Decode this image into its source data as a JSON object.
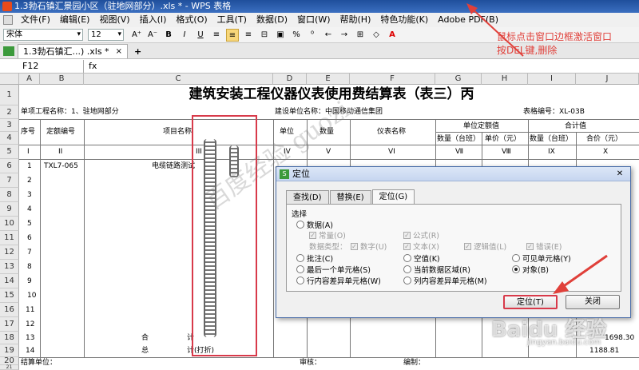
{
  "window": {
    "title": "1.3勃石镇汇景园小区（驻地网部分）.xls * - WPS 表格"
  },
  "menu": [
    "文件(F)",
    "编辑(E)",
    "视图(V)",
    "插入(I)",
    "格式(O)",
    "工具(T)",
    "数据(D)",
    "窗口(W)",
    "帮助(H)",
    "特色功能(K)",
    "Adobe PDF(B)"
  ],
  "toolbar": {
    "font": "宋体",
    "size": "12",
    "buttons": [
      "A⁺",
      "A⁻",
      "B",
      "I",
      "U",
      "≡",
      "≡",
      "≡",
      "⊟",
      "▣",
      "%",
      "⁰",
      "←",
      "→",
      "⊞",
      "◇",
      "A"
    ]
  },
  "doc_tab": {
    "label": "1.3勃石镇汇...) .xls *",
    "close": "×",
    "add": "+"
  },
  "formula_bar": {
    "cell_ref": "F12",
    "fx": "fx"
  },
  "columns": [
    "A",
    "B",
    "C",
    "D",
    "E",
    "F",
    "G",
    "H",
    "I",
    "J"
  ],
  "rows": [
    "1",
    "2",
    "3",
    "4",
    "5",
    "6",
    "7",
    "8",
    "9",
    "10",
    "11",
    "12",
    "13",
    "14",
    "15",
    "16",
    "17",
    "18",
    "19",
    "20",
    "21"
  ],
  "sheet": {
    "title": "建筑安装工程仪器仪表使用费结算表（表三）丙",
    "project_name": "单项工程名称：1、驻地网部分",
    "builder": "建设单位名称：中国移动通信集团",
    "table_no": "表格编号：XL-03B",
    "h_seq": "序号",
    "h_quota": "定额编号",
    "h_item": "项目名称",
    "h_unit": "单位",
    "h_qty": "数量",
    "h_meter": "仪表名称",
    "h_unit_quota": "单位定额值",
    "h_total": "合计值",
    "h_qty_shift": "数量（台班）",
    "h_unit_price": "单价（元）",
    "h_qty_shift2": "数量（台班）",
    "h_total_price": "合价（元）",
    "r5": [
      "I",
      "II",
      "III",
      "IV",
      "V",
      "VI",
      "Ⅶ",
      "Ⅷ",
      "IX",
      "X"
    ],
    "r6": [
      "1",
      "TXL7-065",
      "电缆链路测试"
    ],
    "row_numbers": [
      "2",
      "3",
      "4",
      "5",
      "6",
      "7",
      "8",
      "9",
      "10",
      "11",
      "12"
    ],
    "r18": [
      "13",
      "合",
      "计"
    ],
    "r19": [
      "14",
      "总",
      "计(打折)"
    ],
    "r18_val": "1698.30",
    "r19_val": "1188.81",
    "r20_a": "结算单位：",
    "r20_b": "审核：",
    "r20_c": "编制："
  },
  "dialog": {
    "title": "定位",
    "tabs": [
      "查找(D)",
      "替换(E)",
      "定位(G)"
    ],
    "group": "选择",
    "opt_data": "数据(A)",
    "chk_const": "常量(O)",
    "chk_formula": "公式(R)",
    "data_type": "数据类型：",
    "chk_number": "数字(U)",
    "chk_text": "文本(X)",
    "chk_logic": "逻辑值(L)",
    "chk_error": "错误(E)",
    "opt_comment": "批注(C)",
    "opt_blank": "空值(K)",
    "opt_visible": "可见单元格(Y)",
    "opt_last": "最后一个单元格(S)",
    "opt_region": "当前数据区域(R)",
    "opt_object": "对象(B)",
    "opt_rowdiff": "行内容差异单元格(W)",
    "opt_coldiff": "列内容差异单元格(M)",
    "btn_locate": "定位(T)",
    "btn_close": "关闭"
  },
  "annotation": "鼠标点击窗口边框激活窗口\n按DEL键,删除",
  "watermark": "百度经验 guozi",
  "baidu_logo": "Baidu 经验",
  "baidu_url": "jingyan.baidu.com"
}
